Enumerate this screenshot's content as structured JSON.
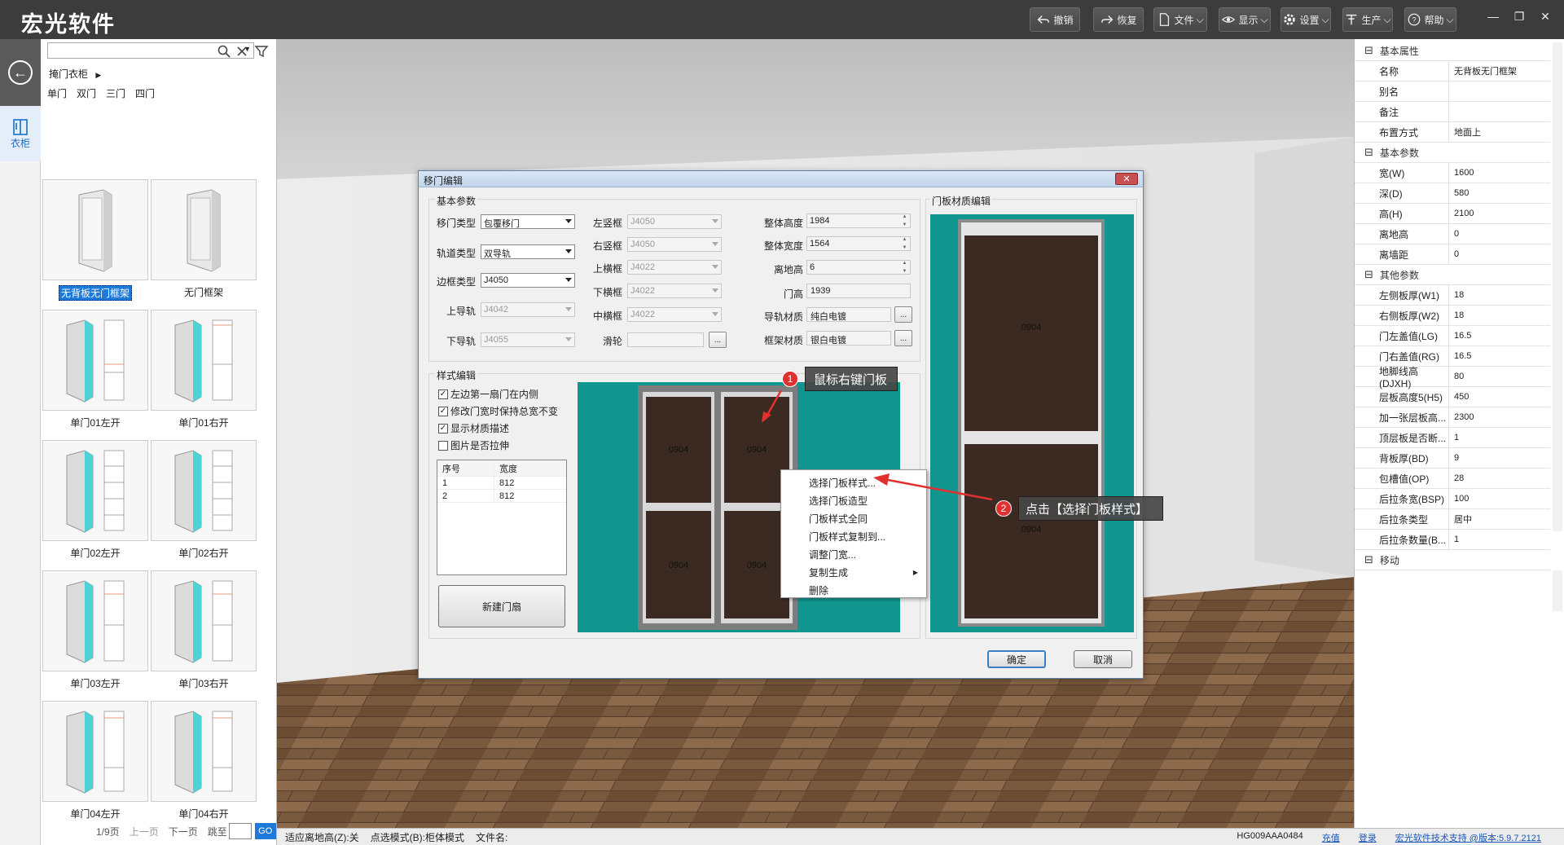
{
  "app": {
    "title": "宏光软件"
  },
  "toolbar": [
    {
      "label": "撤销",
      "icon": "undo-icon"
    },
    {
      "label": "恢复",
      "icon": "redo-icon"
    },
    {
      "label": "文件",
      "icon": "file-icon"
    },
    {
      "label": "显示",
      "icon": "eye-icon"
    },
    {
      "label": "设置",
      "icon": "gear-icon"
    },
    {
      "label": "生产",
      "icon": "production-icon"
    },
    {
      "label": "帮助",
      "icon": "help-icon"
    }
  ],
  "rail": {
    "tab_label": "衣柜"
  },
  "catalog": {
    "breadcrumb": "掩门衣柜",
    "subtabs": [
      "单门",
      "双门",
      "三门",
      "四门"
    ],
    "items": [
      "无背板无门框架",
      "无门框架",
      "单门01左开",
      "单门01右开",
      "单门02左开",
      "单门02右开",
      "单门03左开",
      "单门03右开",
      "单门04左开",
      "单门04右开"
    ],
    "pager": {
      "page": "1/9页",
      "prev": "上一页",
      "next": "下一页",
      "goto": "跳至",
      "go": "GO"
    }
  },
  "dialog": {
    "title": "移门编辑",
    "basic_group": "基本参数",
    "labels": {
      "door_type": "移门类型",
      "track_type": "轨道类型",
      "frame_type": "边框类型",
      "top_track": "上导轨",
      "bottom_track": "下导轨",
      "left_stile": "左竖框",
      "right_stile": "右竖框",
      "top_rail": "上横框",
      "bottom_rail": "下横框",
      "mid_rail": "中横框",
      "pulley": "滑轮",
      "total_height": "整体高度",
      "total_width": "整体宽度",
      "ground_height": "离地高",
      "door_height": "门高",
      "track_material": "导轨材质",
      "frame_material": "框架材质"
    },
    "values": {
      "door_type": "包覆移门",
      "track_type": "双导轨",
      "frame_type": "J4050",
      "top_track": "J4042",
      "bottom_track": "J4055",
      "left_stile": "J4050",
      "right_stile": "J4050",
      "top_rail": "J4022",
      "bottom_rail": "J4022",
      "mid_rail": "J4022",
      "total_height": "1984",
      "total_width": "1564",
      "ground_height": "6",
      "door_height": "1939",
      "track_material": "纯白电镀",
      "frame_material": "银白电镀"
    },
    "style_group": "样式编辑",
    "checkboxes": [
      {
        "label": "左边第一扇门在内侧",
        "checked": true
      },
      {
        "label": "修改门宽时保持总宽不变",
        "checked": true
      },
      {
        "label": "显示材质描述",
        "checked": true
      },
      {
        "label": "图片是否拉伸",
        "checked": false
      }
    ],
    "table": {
      "headers": [
        "序号",
        "宽度"
      ],
      "rows": [
        [
          "1",
          "812"
        ],
        [
          "2",
          "812"
        ]
      ]
    },
    "new_door_button": "新建门扇",
    "material_group": "门板材质编辑",
    "panel_code": "0904",
    "ok": "确定",
    "cancel": "取消"
  },
  "context_menu": [
    "选择门板样式...",
    "选择门板造型",
    "门板样式全同",
    "门板样式复制到...",
    "调整门宽...",
    "复制生成",
    "删除"
  ],
  "callouts": [
    {
      "num": "1",
      "text": "鼠标右键门板"
    },
    {
      "num": "2",
      "text": "点击【选择门板样式】"
    }
  ],
  "properties": {
    "sections": [
      {
        "title": "基本属性",
        "rows": [
          [
            "名称",
            "无背板无门框架"
          ],
          [
            "别名",
            ""
          ],
          [
            "备注",
            ""
          ],
          [
            "布置方式",
            "地面上"
          ]
        ]
      },
      {
        "title": "基本参数",
        "rows": [
          [
            "宽(W)",
            "1600"
          ],
          [
            "深(D)",
            "580"
          ],
          [
            "高(H)",
            "2100"
          ],
          [
            "离地高",
            "0"
          ],
          [
            "离墙距",
            "0"
          ]
        ]
      },
      {
        "title": "其他参数",
        "rows": [
          [
            "左侧板厚(W1)",
            "18"
          ],
          [
            "右侧板厚(W2)",
            "18"
          ],
          [
            "门左盖值(LG)",
            "16.5"
          ],
          [
            "门右盖值(RG)",
            "16.5"
          ],
          [
            "地脚线高(DJXH)",
            "80"
          ],
          [
            "层板高度5(H5)",
            "450"
          ],
          [
            "加一张层板高...",
            "2300"
          ],
          [
            "顶层板是否断...",
            "1"
          ],
          [
            "背板厚(BD)",
            "9"
          ],
          [
            "包槽值(OP)",
            "28"
          ],
          [
            "后拉条宽(BSP)",
            "100"
          ],
          [
            "后拉条类型",
            "居中"
          ],
          [
            "后拉条数量(B...",
            "1"
          ]
        ]
      },
      {
        "title": "移动",
        "rows": []
      }
    ]
  },
  "statusbar": {
    "left": [
      "适应离地高(Z):关",
      "点选模式(B):柜体模式",
      "文件名:"
    ],
    "right": [
      "HG009AAA0484",
      "充值",
      "登录",
      "宏光软件技术支持 @版本:5.9.7.2121"
    ]
  }
}
